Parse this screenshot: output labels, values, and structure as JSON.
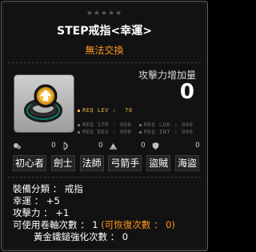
{
  "header": {
    "stars": "★★★★★",
    "title": "STEP戒指<幸運>",
    "trade_note": "無法交換"
  },
  "attack_increase": {
    "label": "攻擊力增加量",
    "value": "0"
  },
  "requirements": {
    "lev_label": "REQ LEV :",
    "lev_value": "70",
    "str": "REQ STR : 000",
    "luk": "REQ LUK : 000",
    "dex": "REQ DEX : 000",
    "int": "REQ INT : 000"
  },
  "icons_row": [
    {
      "icon": "pet-icon",
      "value": "0"
    },
    {
      "icon": "bow-icon",
      "value": "0"
    },
    {
      "icon": "hat-icon",
      "value": "0"
    },
    {
      "icon": "shield-icon",
      "value": "0"
    }
  ],
  "jobs": [
    "初心者",
    "劍士",
    "法師",
    "弓箭手",
    "盜賊",
    "海盜"
  ],
  "stats": {
    "category": "裝備分類 ： 戒指",
    "luck": "幸運 ： +5",
    "attack": "攻擊力 ： +1",
    "upgrades_prefix": "可使用卷軸次數 ： 1 ",
    "upgrades_recover": "(可恢復次數 ： 0)",
    "hammer": "黃金鐵鎚強化次數 ： 0"
  },
  "colors": {
    "accent_orange": "#ff9a1f",
    "req_level_gold": "#e8b64a",
    "req_gray": "#6d6d6d"
  }
}
